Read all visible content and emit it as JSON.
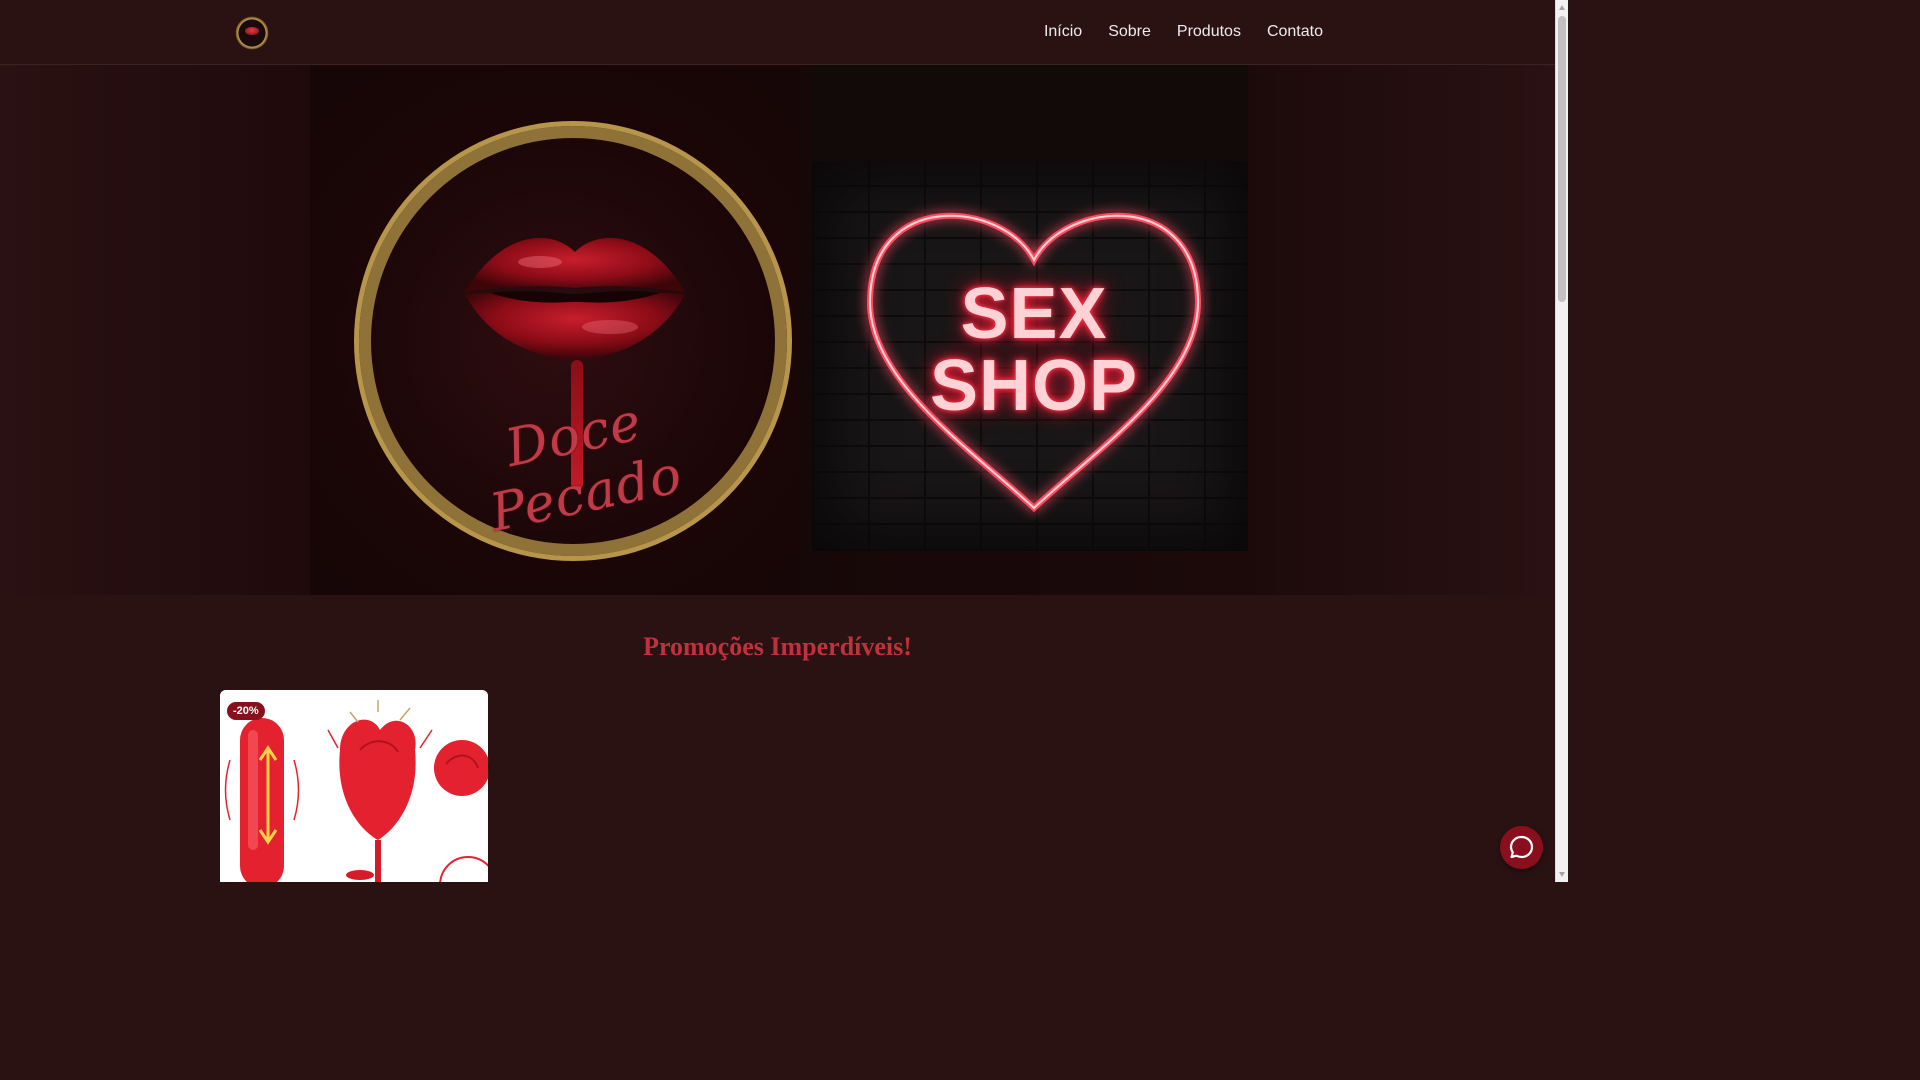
{
  "header": {
    "logo_icon": "doce-pecado-logo",
    "nav": [
      "Início",
      "Sobre",
      "Produtos",
      "Contato"
    ]
  },
  "hero": {
    "brand_script": "Doce Pecado",
    "neon_line1": "SEX",
    "neon_line2": "SHOP"
  },
  "promo": {
    "title": "Promoções Imperdíveis!",
    "products": [
      {
        "badge": "-20%"
      }
    ]
  },
  "floating_button": {
    "icon": "chat-bubble-icon"
  },
  "colors": {
    "background": "#2a1213",
    "accent": "#c0313d",
    "badge": "#8a0f1c",
    "gold": "#b7964b"
  }
}
